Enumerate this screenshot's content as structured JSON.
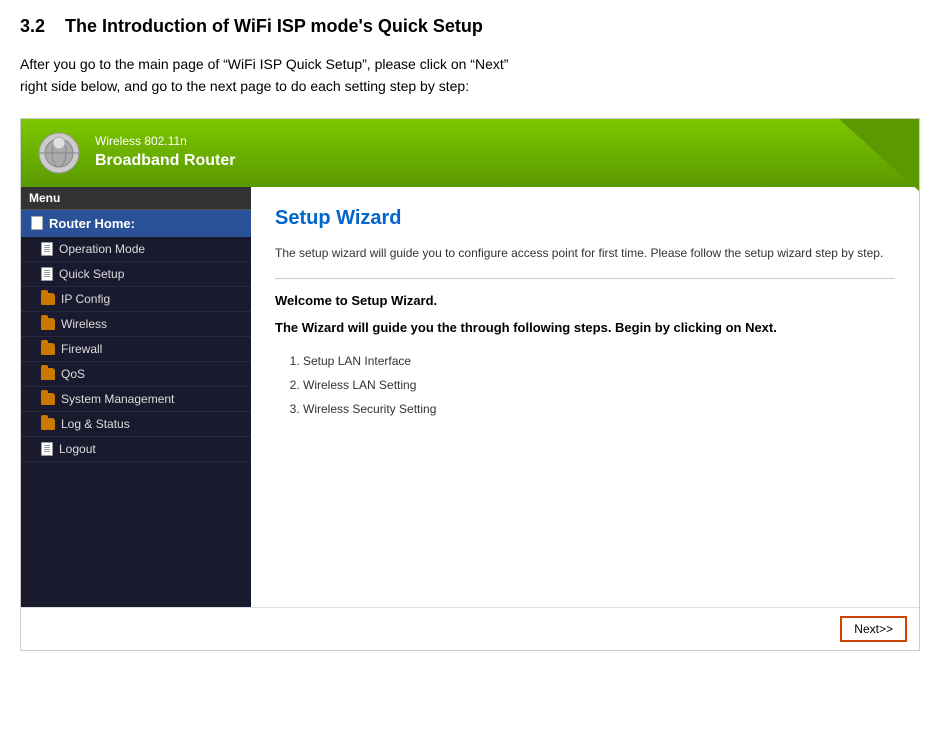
{
  "page": {
    "section": "3.2",
    "title": "The Introduction of WiFi ISP mode's Quick Setup",
    "description_line1": "After you go to the main page of “WiFi ISP Quick Setup”, please click on “Next”",
    "description_line2": "right side below, and go to the next page to do each setting step by step:"
  },
  "router": {
    "header": {
      "line1": "Wireless 802.11n",
      "line2": "Broadband Router"
    },
    "sidebar": {
      "menu_label": "Menu",
      "home_item": "Router Home:",
      "items": [
        {
          "label": "Operation Mode",
          "type": "doc"
        },
        {
          "label": "Quick Setup",
          "type": "doc"
        },
        {
          "label": "IP Config",
          "type": "folder"
        },
        {
          "label": "Wireless",
          "type": "folder"
        },
        {
          "label": "Firewall",
          "type": "folder"
        },
        {
          "label": "QoS",
          "type": "folder"
        },
        {
          "label": "System Management",
          "type": "folder"
        },
        {
          "label": "Log & Status",
          "type": "folder"
        },
        {
          "label": "Logout",
          "type": "doc"
        }
      ]
    },
    "main": {
      "wizard_title": "Setup Wizard",
      "description": "The setup wizard will guide you to configure access point for first time. Please follow the setup wizard step by step.",
      "welcome": "Welcome to Setup Wizard.",
      "steps_intro": "The Wizard will guide you the through following steps. Begin by clicking on Next.",
      "steps": [
        "Setup LAN Interface",
        "Wireless LAN Setting",
        "Wireless Security Setting"
      ]
    },
    "footer": {
      "next_button": "Next>>"
    }
  }
}
